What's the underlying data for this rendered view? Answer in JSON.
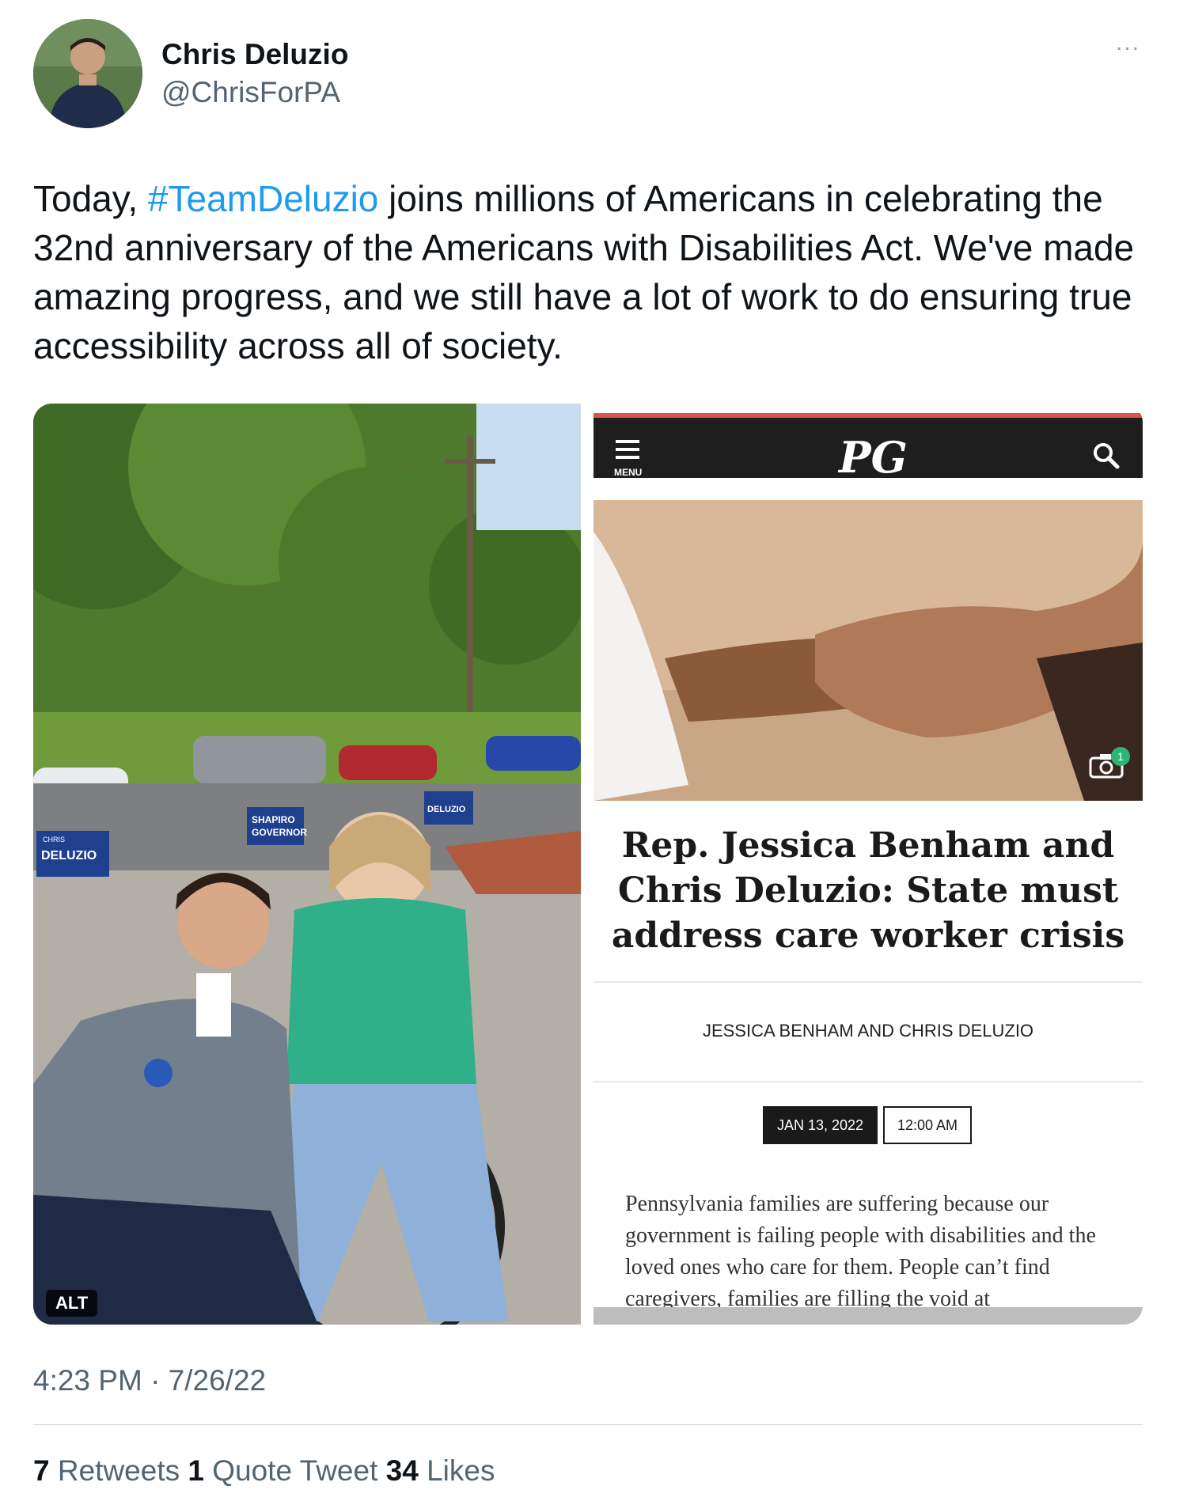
{
  "author": {
    "name": "Chris Deluzio",
    "handle": "@ChrisForPA"
  },
  "tweet": {
    "text_before": "Today, ",
    "hashtag": "#TeamDeluzio",
    "text_after": " joins millions of Americans in celebrating the 32nd anniversary of the Americans with Disabilities Act. We've made amazing progress, and we still have a lot of work to do ensuring true accessibility across all of society."
  },
  "more_button": "···",
  "media": {
    "alt_badge": "ALT",
    "article": {
      "menu_label": "MENU",
      "logo": "PG",
      "camera_count": "1",
      "title": "Rep. Jessica Benham and Chris Deluzio: State must address care worker crisis",
      "byline": "JESSICA BENHAM AND CHRIS DELUZIO",
      "date": "JAN 13, 2022",
      "time": "12:00 AM",
      "body": "Pennsylvania families are suffering because our government is failing people with disabilities and the loved ones who care for them. People can’t find caregivers, families are filling the void at"
    },
    "photo_signs": {
      "sign_1_small": "CHRIS",
      "sign_1": "DELUZIO",
      "sign_2_line1": "SHAPIRO",
      "sign_2_line2": "GOVERNOR",
      "sign_3": "DELUZIO"
    }
  },
  "timestamp": "4:23 PM · 7/26/22",
  "stats": {
    "retweets_count": "7",
    "retweets_label": "Retweets",
    "quotes_count": "1",
    "quotes_label": "Quote Tweet",
    "likes_count": "34",
    "likes_label": "Likes"
  },
  "colors": {
    "link": "#1d9bf0",
    "secondary_text": "#536471",
    "primary_text": "#0f1419"
  }
}
